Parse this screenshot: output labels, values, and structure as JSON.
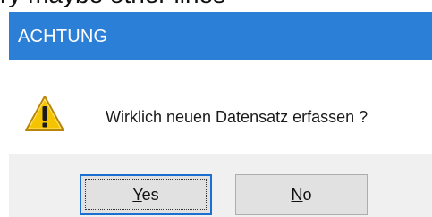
{
  "top_fragment": "ry maybe other lines",
  "dialog": {
    "title": "ACHTUNG",
    "message": "Wirklich neuen Datensatz erfassen ?",
    "icon": "warning-icon",
    "buttons": {
      "yes": {
        "accel": "Y",
        "rest": "es"
      },
      "no": {
        "accel": "N",
        "rest": "o"
      }
    }
  },
  "colors": {
    "titlebar": "#2b7fd6",
    "button_bar": "#f0f0f0",
    "default_button_border": "#1a6fd1",
    "warning_fill": "#f5c400"
  }
}
